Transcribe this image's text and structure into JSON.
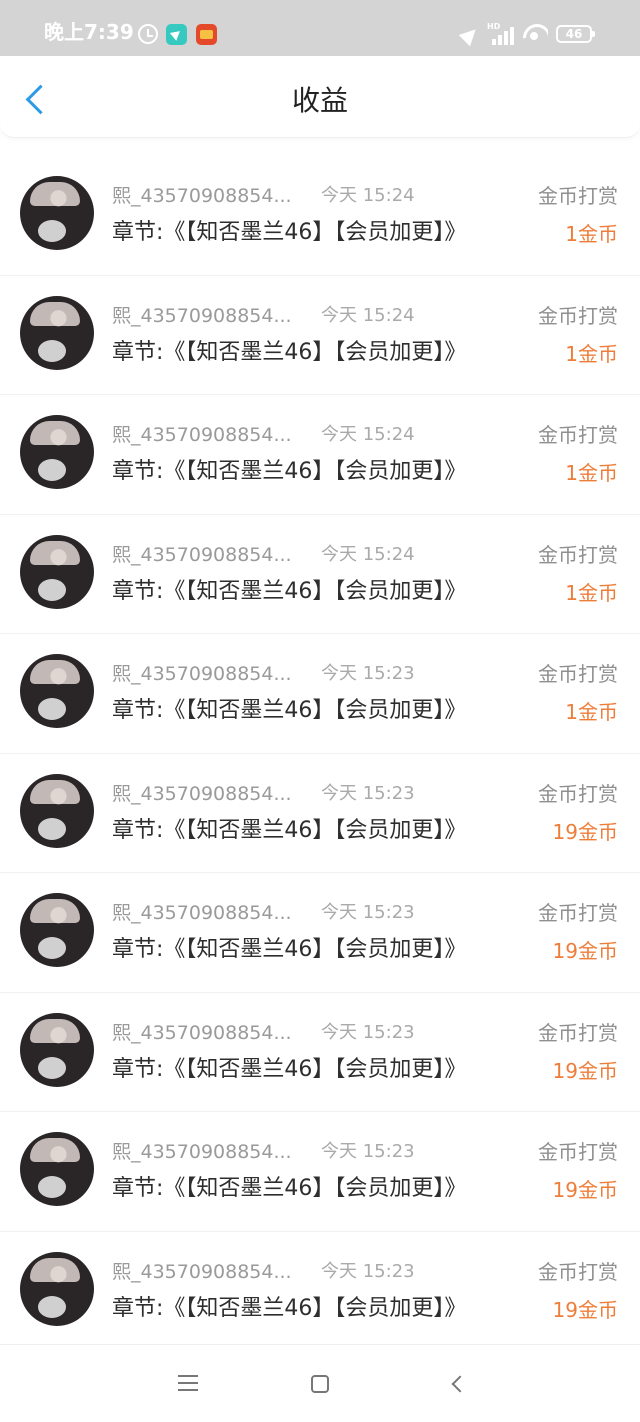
{
  "status_bar": {
    "time": "晚上7:39",
    "battery": "46",
    "network_label": "HD",
    "icons": [
      "alarm-icon",
      "app-icon-navigation",
      "app-icon-novel",
      "location-icon",
      "signal-icon",
      "wifi-icon",
      "battery-icon"
    ]
  },
  "header": {
    "title": "收益",
    "back_icon": "chevron-left-icon"
  },
  "records": [
    {
      "name": "熙_43570908854...",
      "time": "今天 15:24",
      "chapter": "章节:《【知否墨兰46】【会员加更】》",
      "type": "金币打赏",
      "amount": "1金币"
    },
    {
      "name": "熙_43570908854...",
      "time": "今天 15:24",
      "chapter": "章节:《【知否墨兰46】【会员加更】》",
      "type": "金币打赏",
      "amount": "1金币"
    },
    {
      "name": "熙_43570908854...",
      "time": "今天 15:24",
      "chapter": "章节:《【知否墨兰46】【会员加更】》",
      "type": "金币打赏",
      "amount": "1金币"
    },
    {
      "name": "熙_43570908854...",
      "time": "今天 15:24",
      "chapter": "章节:《【知否墨兰46】【会员加更】》",
      "type": "金币打赏",
      "amount": "1金币"
    },
    {
      "name": "熙_43570908854...",
      "time": "今天 15:23",
      "chapter": "章节:《【知否墨兰46】【会员加更】》",
      "type": "金币打赏",
      "amount": "1金币"
    },
    {
      "name": "熙_43570908854...",
      "time": "今天 15:23",
      "chapter": "章节:《【知否墨兰46】【会员加更】》",
      "type": "金币打赏",
      "amount": "19金币"
    },
    {
      "name": "熙_43570908854...",
      "time": "今天 15:23",
      "chapter": "章节:《【知否墨兰46】【会员加更】》",
      "type": "金币打赏",
      "amount": "19金币"
    },
    {
      "name": "熙_43570908854...",
      "time": "今天 15:23",
      "chapter": "章节:《【知否墨兰46】【会员加更】》",
      "type": "金币打赏",
      "amount": "19金币"
    },
    {
      "name": "熙_43570908854...",
      "time": "今天 15:23",
      "chapter": "章节:《【知否墨兰46】【会员加更】》",
      "type": "金币打赏",
      "amount": "19金币"
    },
    {
      "name": "熙_43570908854...",
      "time": "今天 15:23",
      "chapter": "章节:《【知否墨兰46】【会员加更】》",
      "type": "金币打赏",
      "amount": "19金币"
    }
  ],
  "bottom_nav": {
    "icons": [
      "menu-icon",
      "home-icon",
      "back-icon"
    ]
  },
  "colors": {
    "accent": "#2b9ae8",
    "amount": "#ef7d3a",
    "status_bar_bg": "#d4d4d4"
  }
}
